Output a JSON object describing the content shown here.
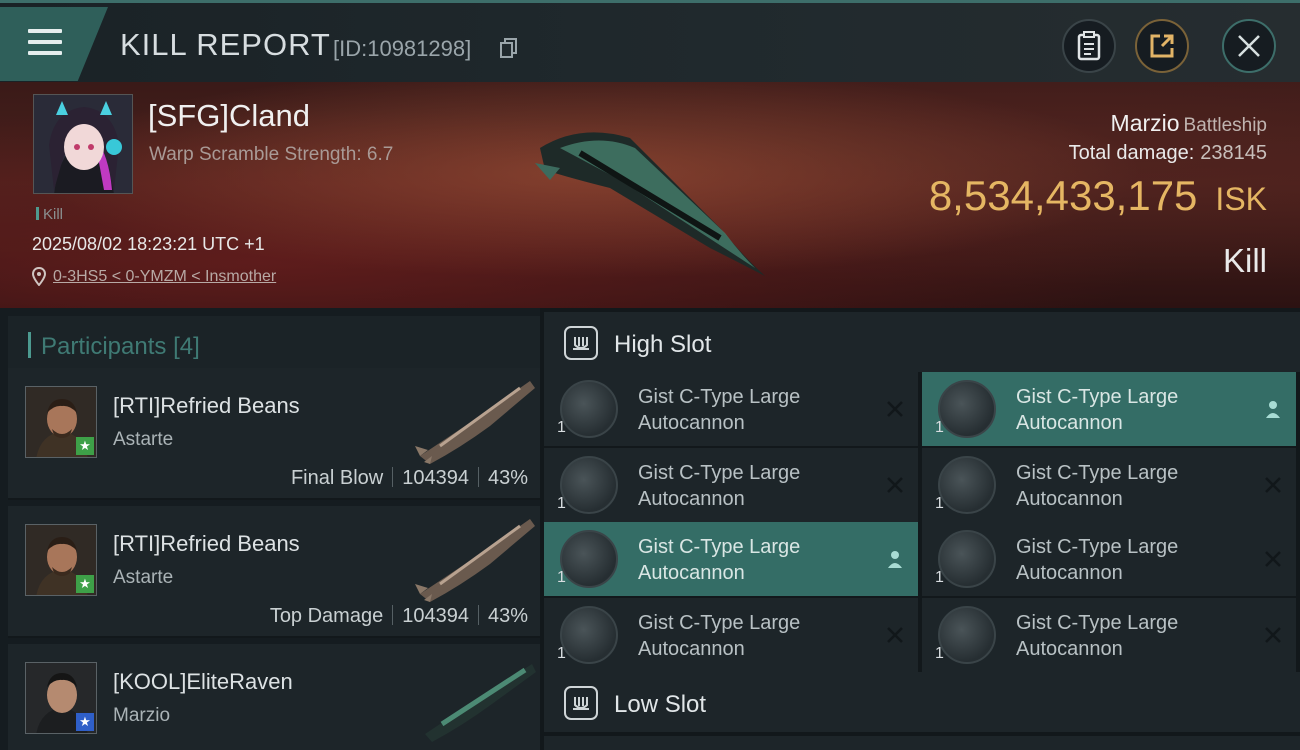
{
  "header": {
    "title": "KILL REPORT",
    "report_id": "[ID:10981298]",
    "menu_icon": "hamburger-icon",
    "buttons": [
      "clipboard-icon",
      "share-icon",
      "close-icon"
    ],
    "accent": "#3d6e6a"
  },
  "victim": {
    "name": "[SFG]Cland",
    "scramble": "Warp Scramble Strength: 6.7",
    "tag": "Kill",
    "datetime": "2025/08/02 18:23:21 UTC +1",
    "location": "0-3HS5 < 0-YMZM < Insmother",
    "ship": "Marzio",
    "ship_class": "Battleship",
    "total_damage_label": "Total damage:",
    "total_damage": "238145",
    "isk_value": "8,534,433,175",
    "isk_unit": "ISK",
    "result": "Kill",
    "isk_color": "#e5b663"
  },
  "participants": {
    "label": "Participants",
    "count": "[4]",
    "rows": [
      {
        "name": "[RTI]Refried Beans",
        "ship": "Astarte",
        "role": "Final Blow",
        "damage": "104394",
        "percent": "43%",
        "badge": "green-star-icon"
      },
      {
        "name": "[RTI]Refried Beans",
        "ship": "Astarte",
        "role": "Top Damage",
        "damage": "104394",
        "percent": "43%",
        "badge": "green-star-icon"
      },
      {
        "name": "[KOOL]EliteRaven",
        "ship": "Marzio",
        "badge": "blue-star-icon"
      }
    ]
  },
  "slots": {
    "high": {
      "label": "High Slot",
      "modules": [
        {
          "line1": "Gist C-Type Large",
          "line2": "Autocannon",
          "qty": "1",
          "state": "destroyed"
        },
        {
          "line1": "Gist C-Type Large",
          "line2": "Autocannon",
          "qty": "1",
          "state": "dropped"
        },
        {
          "line1": "Gist C-Type Large",
          "line2": "Autocannon",
          "qty": "1",
          "state": "destroyed"
        },
        {
          "line1": "Gist C-Type Large",
          "line2": "Autocannon",
          "qty": "1",
          "state": "destroyed"
        },
        {
          "line1": "Gist C-Type Large",
          "line2": "Autocannon",
          "qty": "1",
          "state": "dropped"
        },
        {
          "line1": "Gist C-Type Large",
          "line2": "Autocannon",
          "qty": "1",
          "state": "destroyed"
        },
        {
          "line1": "Gist C-Type Large",
          "line2": "Autocannon",
          "qty": "1",
          "state": "destroyed"
        },
        {
          "line1": "Gist C-Type Large",
          "line2": "Autocannon",
          "qty": "1",
          "state": "destroyed"
        }
      ]
    },
    "low": {
      "label": "Low Slot"
    }
  }
}
